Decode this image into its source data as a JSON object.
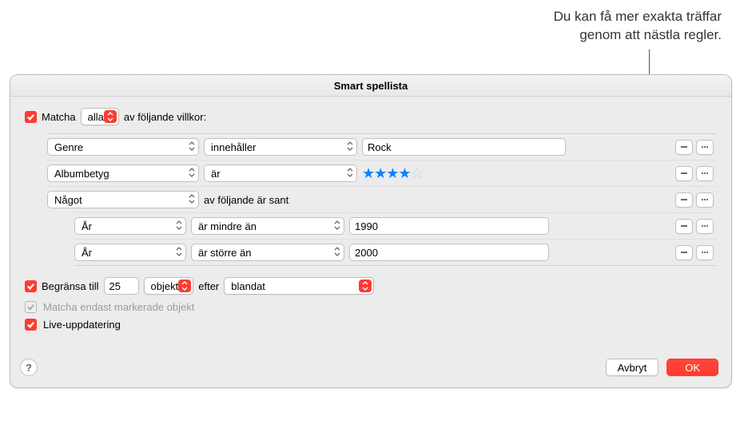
{
  "annotation": {
    "line1": "Du kan få mer exakta träffar",
    "line2": "genom att nästla regler."
  },
  "window": {
    "title": "Smart spellista"
  },
  "match": {
    "label_before": "Matcha",
    "mode": "alla",
    "label_after": "av följande villkor:"
  },
  "rules": [
    {
      "field": "Genre",
      "op": "innehåller",
      "value": "Rock",
      "type": "text"
    },
    {
      "field": "Albumbetyg",
      "op": "är",
      "stars": 4,
      "type": "stars"
    },
    {
      "field": "Något",
      "suffix": "av följande är sant",
      "type": "group"
    },
    {
      "field": "År",
      "op": "är mindre än",
      "value": "1990",
      "type": "nested"
    },
    {
      "field": "År",
      "op": "är större än",
      "value": "2000",
      "type": "nested"
    }
  ],
  "limit": {
    "label": "Begränsa till",
    "count": "25",
    "unit": "objekt",
    "by_label": "efter",
    "by_value": "blandat"
  },
  "checked_only": {
    "label": "Matcha endast markerade objekt"
  },
  "live": {
    "label": "Live-uppdatering"
  },
  "buttons": {
    "cancel": "Avbryt",
    "ok": "OK",
    "help": "?"
  }
}
